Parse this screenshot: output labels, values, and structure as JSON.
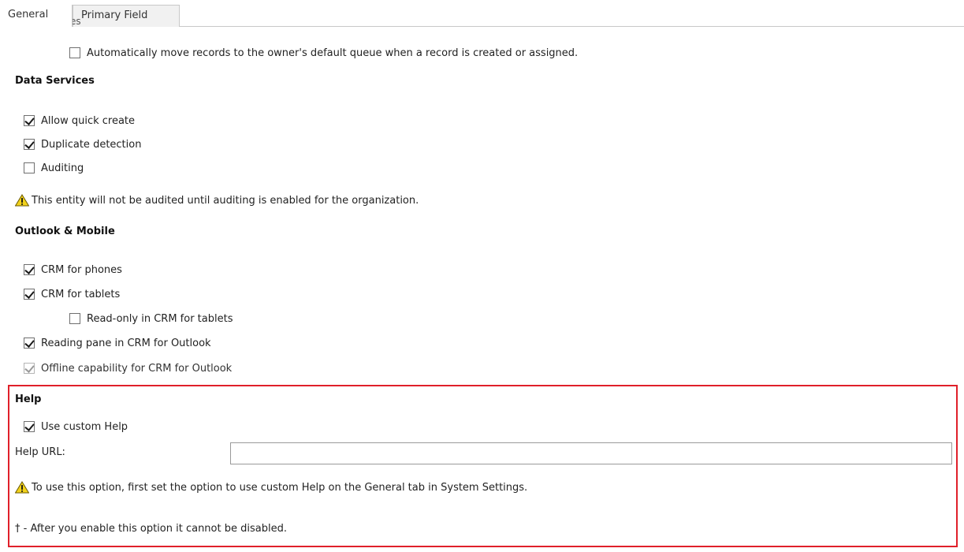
{
  "tabs": [
    {
      "label": "General"
    },
    {
      "label": "Primary Field"
    }
  ],
  "queues": {
    "label": "Queues",
    "auto_move_label": "Automatically move records to the owner's default queue when a record is created or assigned.",
    "auto_move_checked": false
  },
  "data_services": {
    "heading": "Data Services",
    "items": [
      {
        "label": "Allow quick create",
        "checked": true
      },
      {
        "label": "Duplicate detection",
        "checked": true
      },
      {
        "label": "Auditing",
        "checked": false
      }
    ],
    "warning": "This entity will not be audited until auditing is enabled for the organization."
  },
  "outlook_mobile": {
    "heading": "Outlook & Mobile",
    "items": [
      {
        "label": "CRM for phones",
        "checked": true
      },
      {
        "label": "CRM for tablets",
        "checked": true
      },
      {
        "label": "Read-only in CRM for tablets",
        "checked": false
      },
      {
        "label": "Reading pane in CRM for Outlook",
        "checked": true
      },
      {
        "label": "Offline capability for CRM for Outlook",
        "checked": true,
        "disabled": true
      }
    ]
  },
  "help": {
    "heading": "Help",
    "use_custom_help_label": "Use custom Help",
    "use_custom_help_checked": true,
    "url_label": "Help URL:",
    "url_value": "",
    "warning": "To use this option, first set the option to use custom Help on the General tab in System Settings.",
    "footnote": "† - After you enable this option it cannot be disabled."
  },
  "colors": {
    "highlight_border": "#e0202a",
    "warning_icon": "#f2d21b"
  }
}
